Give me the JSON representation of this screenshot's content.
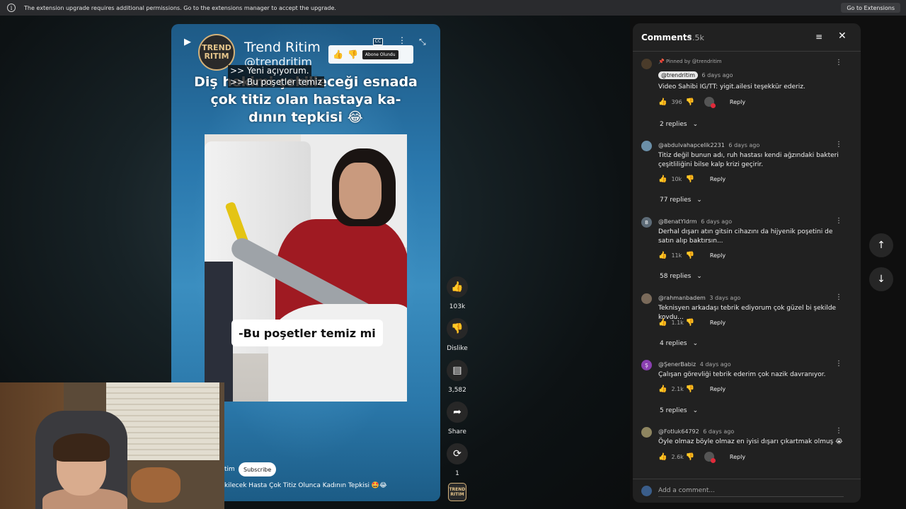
{
  "banner": {
    "text": "The extension upgrade requires additional permissions. Go to the extensions manager to accept the upgrade.",
    "button": "Go to Extensions"
  },
  "short": {
    "brand_logo": "TREND RITIM",
    "brand_name": "Trend Ritim",
    "brand_handle": "@trendritim",
    "mini_abone": "Abone Olundu",
    "cc": "CC",
    "captions": [
      ">> Yeni açıyorum.",
      ">> Bu poşetler temiz"
    ],
    "headline": "Diş hekimi çekilleceği esnada çok titiz olan hastaya ka- dının tepkisi 😂",
    "subtitle": "-Bu poşetler temiz mi",
    "channel_tail": "tim",
    "subscribe": "Subscribe",
    "description": "kilecek Hasta Çok Titiz Olunca Kadının Tepkisi 🤩😂"
  },
  "actions": {
    "like_count": "103k",
    "dislike": "Dislike",
    "comments_count": "3,582",
    "share": "Share",
    "remix_count": "1",
    "channel_avatar": "TREND RITIM"
  },
  "comments_panel": {
    "title": "Comments",
    "count": "3.5k",
    "add_placeholder": "Add a comment...",
    "comments": [
      {
        "pinned": "Pinned by @trendritim",
        "author": "@trendritim",
        "time": "6 days ago",
        "text": "Video Sahibi IG/TT: yigit.ailesi teşekkür ederiz.",
        "likes": "396",
        "reply": "Reply",
        "replies": "2 replies"
      },
      {
        "author": "@abdulvahapcelik2231",
        "time": "6 days ago",
        "text": "Titiz değil bunun adı, ruh hastası kendi ağzındaki bakteri çeşitliliğini bilse kalp krizi geçirir.",
        "likes": "10k",
        "reply": "Reply",
        "replies": "77 replies"
      },
      {
        "author": "@BenatYldrm",
        "avatar_letter": "B",
        "time": "6 days ago",
        "text": "Derhal dışarı atın gitsin cihazını da hijyenik poşetini de satın alıp baktırsın...",
        "likes": "11k",
        "reply": "Reply",
        "replies": "58 replies"
      },
      {
        "author": "@rahmanbadem",
        "time": "3 days ago",
        "text": "Teknisyen arkadaşı tebrik ediyorum çok güzel bi şekilde kovdu...",
        "likes": "1.1k",
        "reply": "Reply",
        "replies": "4 replies"
      },
      {
        "author": "@ŞenerBabiz",
        "avatar_letter": "Ş",
        "time": "4 days ago",
        "text": "Çalışan görevliği tebrik ederim çok nazik davranıyor.",
        "likes": "2.1k",
        "reply": "Reply",
        "replies": "5 replies"
      },
      {
        "author": "@Fotluk64792",
        "time": "6 days ago",
        "text": "Öyle olmaz böyle olmaz en iyisi dışarı çıkartmak olmuş 😭",
        "likes": "2.6k",
        "reply": "Reply"
      }
    ]
  },
  "icons": {
    "info": "i",
    "play": "▶",
    "thumb_up": "👍",
    "thumb_down": "👎",
    "comment": "▤",
    "share": "➦",
    "remix": "⟳",
    "sort": "≡",
    "close": "✕",
    "up": "↑",
    "down": "↓",
    "kebab": "⋮",
    "chevron": "⌄"
  },
  "colors": {
    "panel_bg": "#212121",
    "accent_red": "#e02a3a",
    "short_blue": "#2a78ad"
  }
}
